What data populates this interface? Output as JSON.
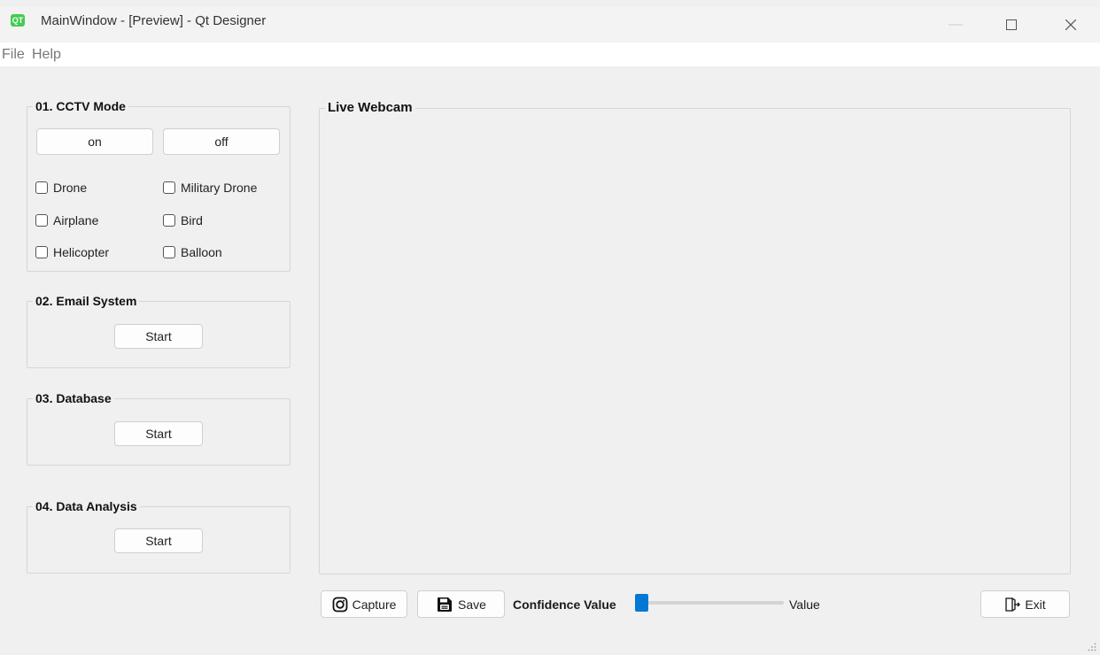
{
  "window": {
    "title": "MainWindow - [Preview] - Qt Designer",
    "app_icon_text": "QT"
  },
  "menubar": {
    "items": [
      "File",
      "Help"
    ]
  },
  "cctv": {
    "title": "01. CCTV Mode",
    "on_label": "on",
    "off_label": "off",
    "checkboxes": [
      "Drone",
      "Military Drone",
      "Airplane",
      "Bird",
      "Helicopter",
      "Balloon"
    ]
  },
  "email": {
    "title": "02. Email System",
    "start_label": "Start"
  },
  "database": {
    "title": "03. Database",
    "start_label": "Start"
  },
  "analysis": {
    "title": "04. Data Analysis",
    "start_label": "Start"
  },
  "webcam": {
    "title": "Live Webcam"
  },
  "bottom": {
    "capture_label": "Capture",
    "save_label": "Save",
    "confidence_label": "Confidence Value",
    "confidence_level": 0.0,
    "value_label": "Value",
    "exit_label": "Exit"
  },
  "colors": {
    "accent": "#0078d4",
    "qt_green": "#41cd52"
  }
}
